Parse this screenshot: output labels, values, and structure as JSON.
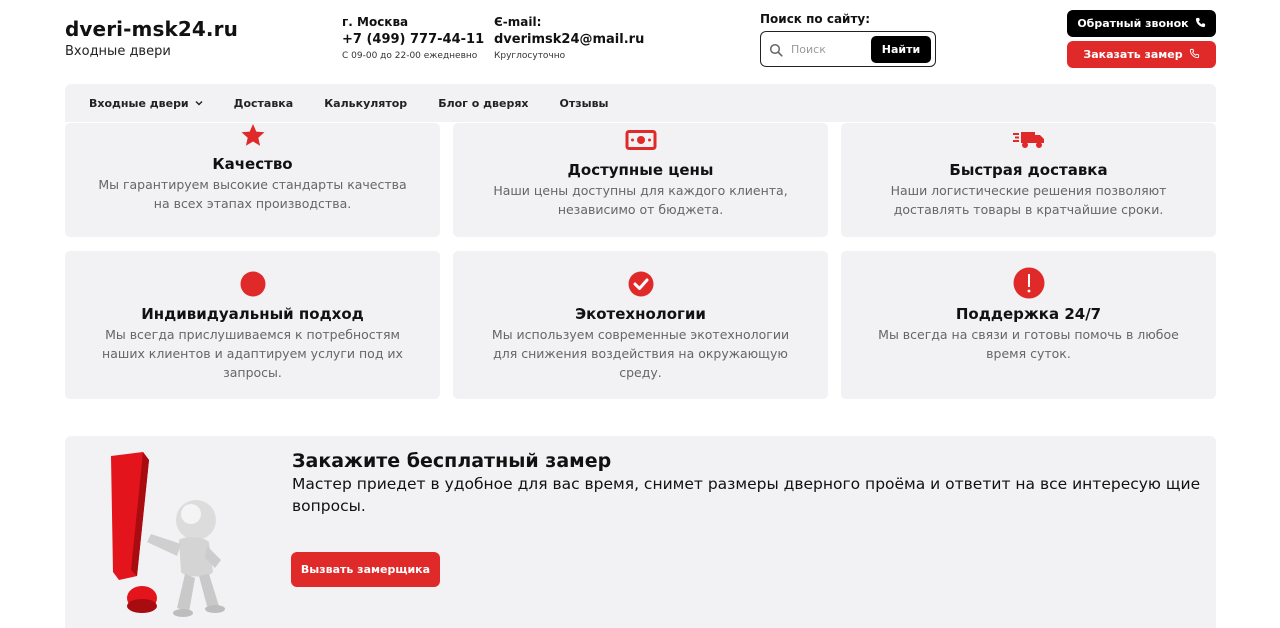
{
  "header": {
    "logo_title": "dveri-msk24.ru",
    "logo_subtitle": "Входные двери",
    "phone": {
      "label": "г. Москва",
      "value": "+7 (499) 777-44-11",
      "note": "С 09-00 до 22-00 ежедневно"
    },
    "email": {
      "label": "Є-mail:",
      "value": "dverimsk24@mail.ru",
      "note": "Круглосуточно"
    },
    "search": {
      "label": "Поиск по сайту:",
      "placeholder": "Поиск",
      "button": "Найти"
    },
    "callback_button": "Обратный звонок",
    "measure_button": "Заказать замер"
  },
  "nav": {
    "items": [
      {
        "label": "Входные двери",
        "dropdown": true
      },
      {
        "label": "Доставка"
      },
      {
        "label": "Калькулятор"
      },
      {
        "label": "Блог о дверях"
      },
      {
        "label": "Отзывы"
      }
    ]
  },
  "features": [
    {
      "icon": "star-icon",
      "title": "Качество",
      "desc": "Мы гарантируем высокие стандарты качества на всех этапах производства."
    },
    {
      "icon": "money-icon",
      "title": "Доступные цены",
      "desc": "Наши цены доступны для каждого клиента, независимо от бюджета."
    },
    {
      "icon": "truck-icon",
      "title": "Быстрая доставка",
      "desc": "Наши логистические решения позволяют доставлять товары в кратчайшие сроки."
    },
    {
      "icon": "circle-icon",
      "title": "Индивидуальный подход",
      "desc": "Мы всегда прислушиваемся к потребностям наших клиентов и адаптируем услуги под их запросы."
    },
    {
      "icon": "check-circle-icon",
      "title": "Экотехнологии",
      "desc": "Мы используем современные экотехнологии для снижения воздействия на окружающую среду."
    },
    {
      "icon": "info-icon",
      "title": "Поддержка 24/7",
      "desc": "Мы всегда на связи и готовы помочь в любое время суток."
    }
  ],
  "promo": {
    "title": "Закажите бесплатный замер",
    "text": "Мастер приедет в удобное для вас время, снимет размеры дверного проёма и ответит на все интересую щие вопросы.",
    "button": "Вызвать замерщика"
  },
  "colors": {
    "accent": "#e02a2a",
    "dark": "#000000",
    "card_bg": "#f2f2f4",
    "muted_text": "#666666"
  }
}
